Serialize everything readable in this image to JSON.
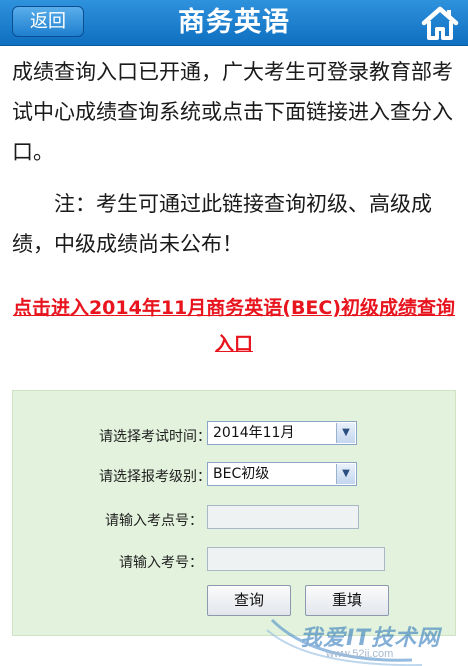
{
  "header": {
    "back_label": "返回",
    "title": "商务英语",
    "home_icon": "home-icon",
    "bar_color": "#1a7ccd"
  },
  "content": {
    "para1": "成绩查询入口已开通，广大考生可登录教育部考试中心成绩查询系统或点击下面链接进入查分入口。",
    "para2": "注：考生可通过此链接查询初级、高级成绩，中级成绩尚未公布！",
    "link_text": "点击进入2014年11月商务英语(BEC)初级成绩查询入口",
    "link_color": "#e8141e"
  },
  "form": {
    "exam_time_label": "请选择考试时间：",
    "exam_time_value": "2014年11月",
    "exam_level_label": "请选择报考级别：",
    "exam_level_value": "BEC初级",
    "center_no_label": "请输入考点号：",
    "center_no_value": "",
    "exam_no_label": "请输入考号：",
    "exam_no_value": "",
    "query_button": "查询",
    "reset_button": "重填",
    "panel_color": "#e3f2dc"
  },
  "watermark": {
    "text": "我爱IT技术网",
    "url": "www.52ij.com"
  }
}
